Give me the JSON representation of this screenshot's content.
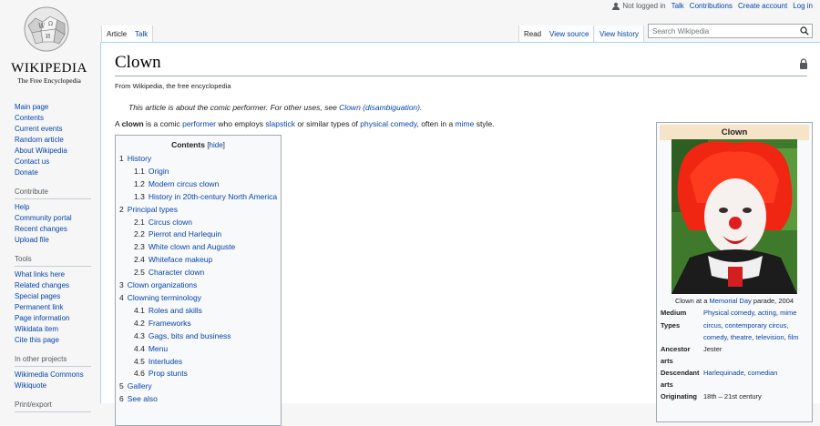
{
  "logo": {
    "wordmark": "Wikipedia",
    "tagline": "The Free Encyclopedia"
  },
  "personal_tools": {
    "status": "Not logged in",
    "links": [
      "Talk",
      "Contributions",
      "Create account",
      "Log in"
    ]
  },
  "tabs": {
    "article": "Article",
    "talk": "Talk",
    "read": "Read",
    "view_source": "View source",
    "view_history": "View history"
  },
  "search": {
    "placeholder": "Search Wikipedia"
  },
  "sidebar": {
    "main": [
      "Main page",
      "Contents",
      "Current events",
      "Random article",
      "About Wikipedia",
      "Contact us",
      "Donate"
    ],
    "contribute": {
      "heading": "Contribute",
      "items": [
        "Help",
        "Community portal",
        "Recent changes",
        "Upload file"
      ]
    },
    "tools": {
      "heading": "Tools",
      "items": [
        "What links here",
        "Related changes",
        "Special pages",
        "Permanent link",
        "Page information",
        "Wikidata item",
        "Cite this page"
      ]
    },
    "other_projects": {
      "heading": "In other projects",
      "items": [
        "Wikimedia Commons",
        "Wikiquote"
      ]
    },
    "print_export": {
      "heading": "Print/export"
    }
  },
  "article": {
    "title": "Clown",
    "site_sub": "From Wikipedia, the free encyclopedia",
    "hatnote": {
      "prefix": "This article is about the comic performer. For other uses, see ",
      "link": "Clown (disambiguation)",
      "suffix": "."
    },
    "lead": {
      "p1": "A ",
      "bold": "clown",
      "p2": " is a comic ",
      "l1": "performer",
      "p3": " who employs ",
      "l2": "slapstick",
      "p4": " or similar types of ",
      "l3": "physical comedy",
      "p5": ", often in a ",
      "l4": "mime",
      "p6": " style."
    }
  },
  "toc": {
    "title": "Contents",
    "hide": "hide",
    "items": [
      {
        "num": "1",
        "text": "History",
        "level": 1
      },
      {
        "num": "1.1",
        "text": "Origin",
        "level": 2
      },
      {
        "num": "1.2",
        "text": "Modern circus clown",
        "level": 2
      },
      {
        "num": "1.3",
        "text": "History in 20th-century North America",
        "level": 2
      },
      {
        "num": "2",
        "text": "Principal types",
        "level": 1
      },
      {
        "num": "2.1",
        "text": "Circus clown",
        "level": 2
      },
      {
        "num": "2.2",
        "text": "Pierrot and Harlequin",
        "level": 2
      },
      {
        "num": "2.3",
        "text": "White clown and Auguste",
        "level": 2
      },
      {
        "num": "2.4",
        "text": "Whiteface makeup",
        "level": 2
      },
      {
        "num": "2.5",
        "text": "Character clown",
        "level": 2
      },
      {
        "num": "3",
        "text": "Clown organizations",
        "level": 1
      },
      {
        "num": "4",
        "text": "Clowning terminology",
        "level": 1
      },
      {
        "num": "4.1",
        "text": "Roles and skills",
        "level": 2
      },
      {
        "num": "4.2",
        "text": "Frameworks",
        "level": 2
      },
      {
        "num": "4.3",
        "text": "Gags, bits and business",
        "level": 2
      },
      {
        "num": "4.4",
        "text": "Menu",
        "level": 2
      },
      {
        "num": "4.5",
        "text": "Interludes",
        "level": 2
      },
      {
        "num": "4.6",
        "text": "Prop stunts",
        "level": 2
      },
      {
        "num": "5",
        "text": "Gallery",
        "level": 1
      },
      {
        "num": "6",
        "text": "See also",
        "level": 1
      }
    ]
  },
  "infobox": {
    "title": "Clown",
    "caption": {
      "pre": "Clown at a ",
      "link": "Memorial Day",
      "post": " parade, 2004"
    },
    "rows": [
      {
        "label": "Medium",
        "value": "Physical comedy, acting, mime"
      },
      {
        "label": "Types",
        "value": "circus, contemporary circus, comedy, theatre, television, film"
      },
      {
        "label": "Ancestor arts",
        "value": "Jester"
      },
      {
        "label": "Descendant arts",
        "value": "Harlequinade, comedian"
      },
      {
        "label": "Originating",
        "value": "18th – 21st century"
      }
    ]
  },
  "colors": {
    "link": "#0645ad",
    "infobox_header": "#f6e4c8",
    "border": "#a7d7f9"
  }
}
